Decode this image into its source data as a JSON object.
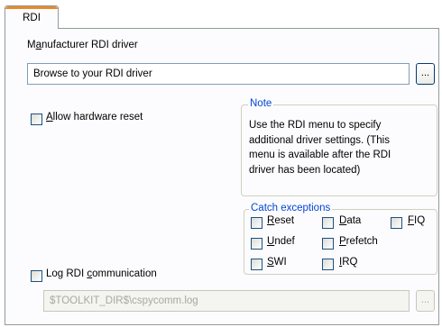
{
  "tab": {
    "label": "RDI"
  },
  "driver": {
    "label_pre": "M",
    "label_u": "a",
    "label_post": "nufacturer RDI driver",
    "value": "Browse to your RDI driver",
    "browse_label": "..."
  },
  "reset": {
    "label_u": "A",
    "label_post": "llow hardware reset"
  },
  "note": {
    "legend": "Note",
    "lines": [
      "Use the RDI menu to specify",
      "additional driver settings. (This",
      "menu is available after the RDI",
      "driver has been located)"
    ]
  },
  "catch": {
    "legend": "Catch exceptions",
    "items": [
      {
        "u": "R",
        "rest": "eset"
      },
      {
        "u": "D",
        "rest": "ata"
      },
      {
        "u": "F",
        "rest": "IQ"
      },
      {
        "u": "U",
        "rest": "ndef"
      },
      {
        "u": "P",
        "rest": "refetch"
      },
      {
        "u": "S",
        "rest": "WI"
      },
      {
        "u": "I",
        "rest": "RQ"
      }
    ]
  },
  "log": {
    "label_pre": "Log RDI ",
    "label_u": "c",
    "label_post": "ommunication",
    "path": "$TOOLKIT_DIR$\\cspycomm.log",
    "browse_label": "..."
  }
}
